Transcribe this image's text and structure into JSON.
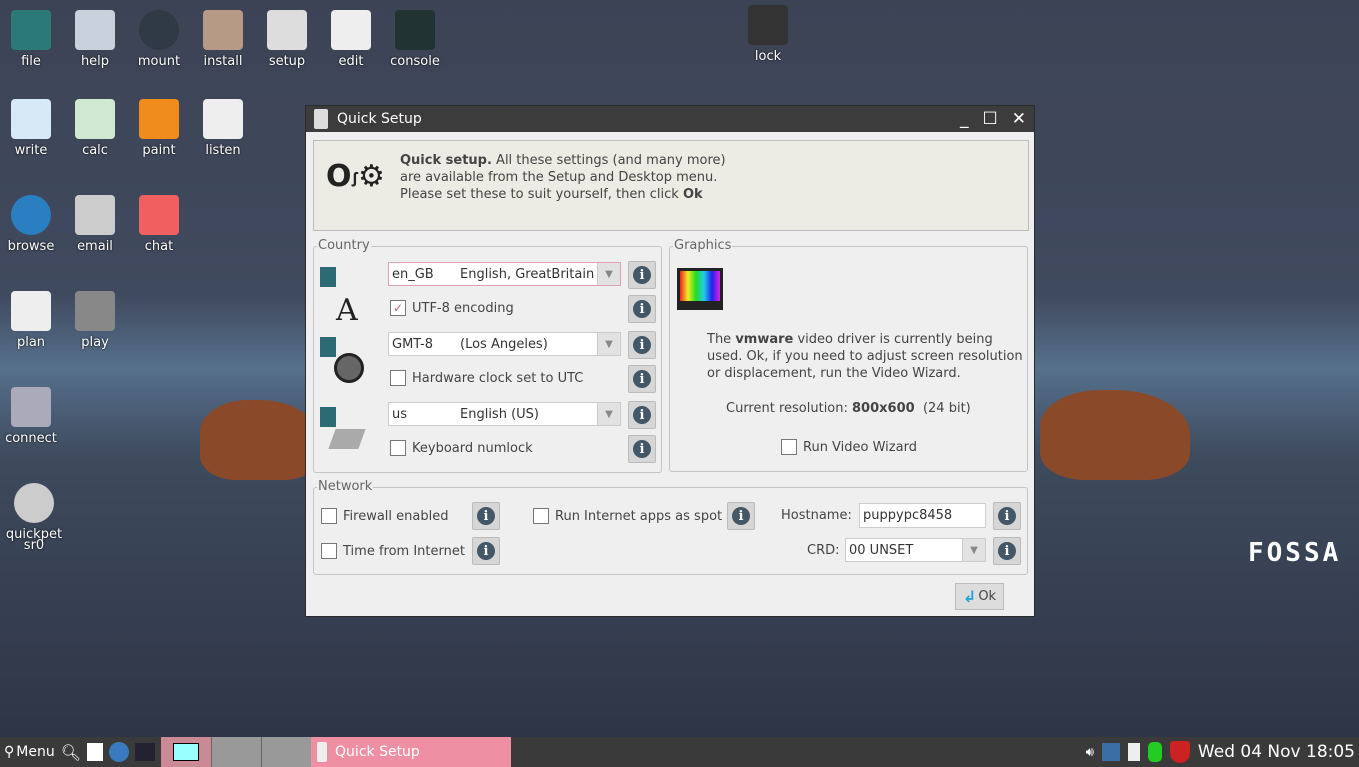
{
  "desktop": {
    "icons": [
      {
        "label": "file",
        "icon": "home-icon"
      },
      {
        "label": "help",
        "icon": "info-icon"
      },
      {
        "label": "mount",
        "icon": "drive-icon"
      },
      {
        "label": "install",
        "icon": "package-icon"
      },
      {
        "label": "setup",
        "icon": "wrench-icon"
      },
      {
        "label": "edit",
        "icon": "notepad-icon"
      },
      {
        "label": "console",
        "icon": "terminal-icon"
      },
      {
        "label": "lock",
        "icon": "lock-icon"
      },
      {
        "label": "write",
        "icon": "document-icon"
      },
      {
        "label": "calc",
        "icon": "spreadsheet-icon"
      },
      {
        "label": "paint",
        "icon": "palette-icon"
      },
      {
        "label": "listen",
        "icon": "music-icon"
      },
      {
        "label": "browse",
        "icon": "globe-icon"
      },
      {
        "label": "email",
        "icon": "envelope-icon"
      },
      {
        "label": "chat",
        "icon": "chat-icon"
      },
      {
        "label": "plan",
        "icon": "calendar-icon"
      },
      {
        "label": "play",
        "icon": "video-icon"
      },
      {
        "label": "connect",
        "icon": "network-icon"
      },
      {
        "label": "quickpet",
        "icon": "disc-icon",
        "sub": "sr0"
      }
    ],
    "brand": "FOSSA"
  },
  "dialog": {
    "title": "Quick Setup",
    "banner": {
      "bold": "Quick setup.",
      "text": " All these settings (and many more) are available from the Setup and Desktop menu. Please set these to suit yourself, then click ",
      "ok": "Ok"
    },
    "country": {
      "legend": "Country",
      "locale_code": "en_GB",
      "locale_name": "English, GreatBritain",
      "utf8": "UTF-8 encoding",
      "utf8_checked": true,
      "tz_code": "GMT-8",
      "tz_name": "(Los Angeles)",
      "hwclock": "Hardware clock set to UTC",
      "kb_code": "us",
      "kb_name": "English (US)",
      "numlock": "Keyboard numlock"
    },
    "graphics": {
      "legend": "Graphics",
      "pre": "The ",
      "driver": "vmware",
      "post": " video driver is currently being used. Ok, if you need to adjust screen resolution or displacement, run the Video Wizard.",
      "res_label": "Current resolution: ",
      "res": "800x600",
      "depth": "(24 bit)",
      "wizard": "Run Video Wizard"
    },
    "network": {
      "legend": "Network",
      "firewall": "Firewall enabled",
      "spot": "Run Internet apps as spot",
      "hostname_label": "Hostname:",
      "hostname": "puppypc8458",
      "timeinet": "Time from Internet",
      "crd_label": "CRD:",
      "crd": "00 UNSET"
    },
    "ok": "Ok"
  },
  "taskbar": {
    "menu": "Menu",
    "task": "Quick Setup",
    "clock": "Wed 04 Nov 18:05"
  },
  "colors": {
    "task_active": "#ee8fa4",
    "titlebar": "#3c3c3c"
  }
}
